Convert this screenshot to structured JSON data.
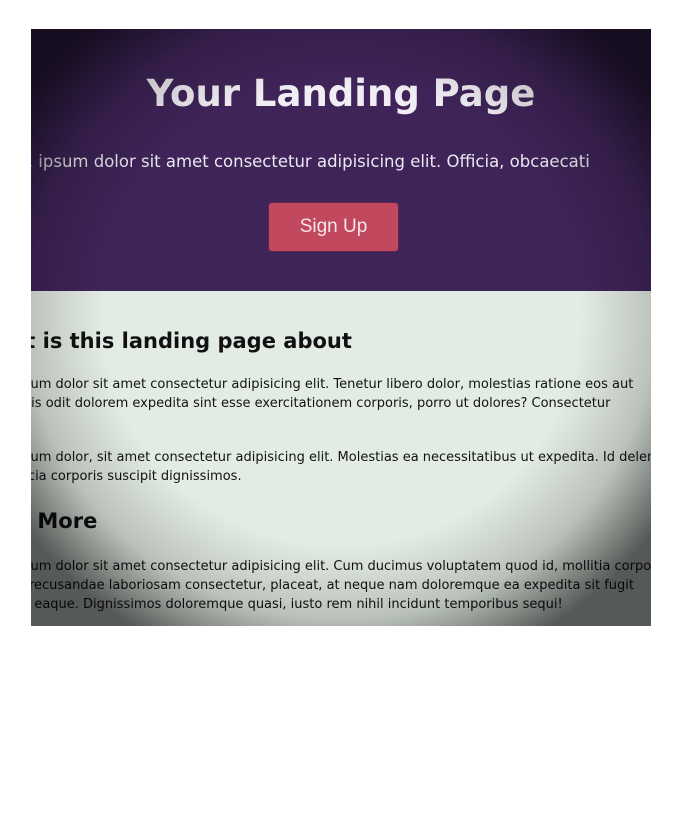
{
  "hero": {
    "title": "Your Landing Page",
    "tagline": "Lorem, ipsum dolor sit amet consectetur adipisicing elit. Officia, obcaecati",
    "signup_label": "Sign Up"
  },
  "about": {
    "heading": "What is this landing page about",
    "p1_line1": "Lorem ipsum dolor sit amet consectetur adipisicing elit. Tenetur libero dolor, molestias ratione eos aut",
    "p1_line2": "quisquam, facilis odit dolorem expedita sint esse exercitationem corporis, porro ut dolores? Consectetur",
    "p2_line1": "Lorem ipsum dolor, sit amet consectetur adipisicing elit. Molestias ea necessitatibus ut expedita. Id deleniti",
    "p2_line2": "ipsam officia corporis suscipit dignissimos."
  },
  "more": {
    "heading": "Learn More",
    "p_line1": "Lorem ipsum dolor sit amet consectetur adipisicing elit. Cum ducimus voluptatem quod id, mollitia corporis",
    "p_line2": "dolore recusandae laboriosam consectetur, placeat, at neque nam doloremque ea expedita sit fugit",
    "p_line3": "veritatis eaque. Dignissimos doloremque quasi, iusto rem nihil incidunt temporibus sequi!"
  },
  "colors": {
    "hero_bg": "#3f2459",
    "button_bg": "#c2485e",
    "content_bg": "#e3ece4"
  }
}
